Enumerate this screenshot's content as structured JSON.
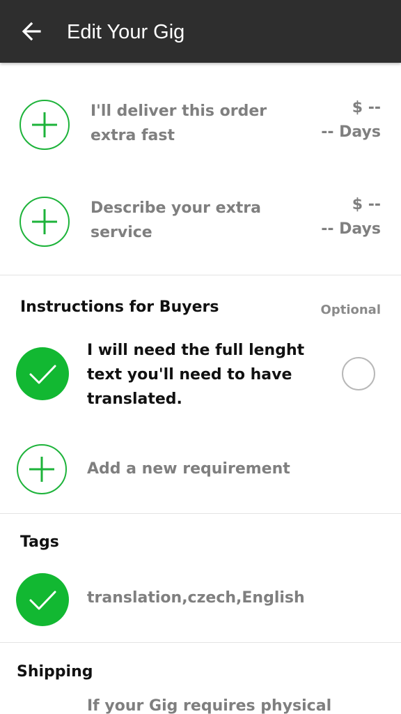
{
  "appbar": {
    "back_icon": "arrow-left-icon",
    "title": "Edit Your Gig"
  },
  "extras": [
    {
      "label_line1": "I'll deliver this order",
      "label_line2": "extra fast",
      "price": "$ --",
      "days": "-- Days",
      "icon": "plus-circle-icon"
    },
    {
      "label_line1": "Describe your extra",
      "label_line2": "service",
      "price": "$ --",
      "days": "-- Days",
      "icon": "plus-circle-icon"
    }
  ],
  "instructions": {
    "title": "Instructions for Buyers",
    "optional_label": "Optional",
    "requirement": {
      "line1": "I will need the full lenght",
      "line2": "text you'll need to have",
      "line3": "translated.",
      "icon": "checkmark-circle-icon",
      "optional_selected": false
    },
    "add_label": "Add a new requirement"
  },
  "tags": {
    "title": "Tags",
    "value": "translation,czech,English",
    "icon": "checkmark-circle-icon"
  },
  "shipping": {
    "title": "Shipping",
    "description_partial": "If your Gig requires physical"
  },
  "colors": {
    "appbar": "#2e2e2e",
    "accent_green": "#12b832",
    "muted_text": "#7f7f7f"
  }
}
